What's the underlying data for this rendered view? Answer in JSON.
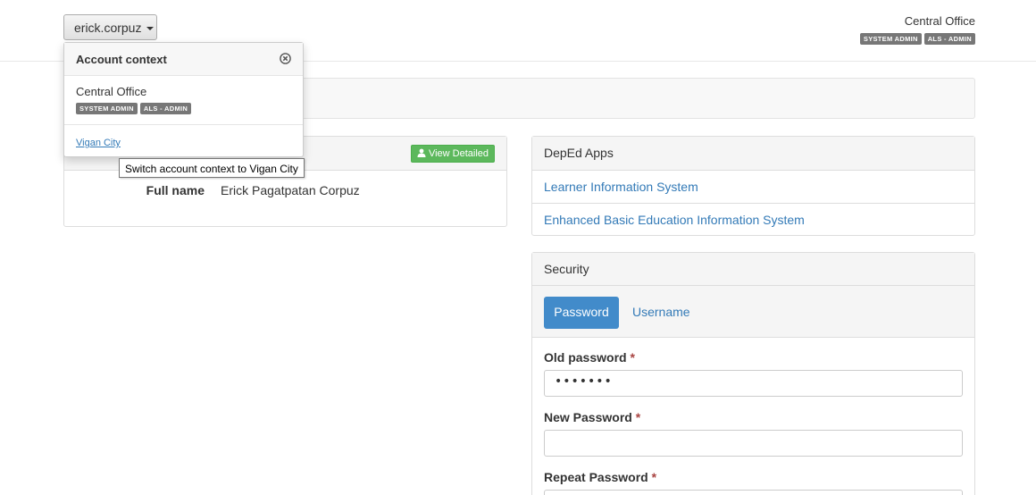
{
  "header": {
    "username": "erick.corpuz",
    "office": "Central Office",
    "roles": [
      "SYSTEM ADMIN",
      "ALS - ADMIN"
    ]
  },
  "dropdown": {
    "title": "Account context",
    "current": {
      "name": "Central Office",
      "roles": [
        "SYSTEM ADMIN",
        "ALS - ADMIN"
      ]
    },
    "other": "Vigan City",
    "tooltip": "Switch account context to Vigan City"
  },
  "profile": {
    "view_button": "View Detailed",
    "fullname_label": "Full name",
    "fullname_value": "Erick Pagatpatan Corpuz"
  },
  "apps": {
    "title": "DepEd Apps",
    "items": [
      "Learner Information System",
      "Enhanced Basic Education Information System"
    ]
  },
  "security": {
    "title": "Security",
    "tabs": [
      "Password",
      "Username"
    ],
    "fields": [
      {
        "label": "Old password",
        "required": "*",
        "value": "•••••••"
      },
      {
        "label": "New Password",
        "required": "*",
        "value": ""
      },
      {
        "label": "Repeat Password",
        "required": "*",
        "value": ""
      }
    ]
  },
  "colors": {
    "primary": "#428bca",
    "success": "#5cb85c",
    "badge": "#777777",
    "link": "#337ab7",
    "required": "#a94442"
  }
}
